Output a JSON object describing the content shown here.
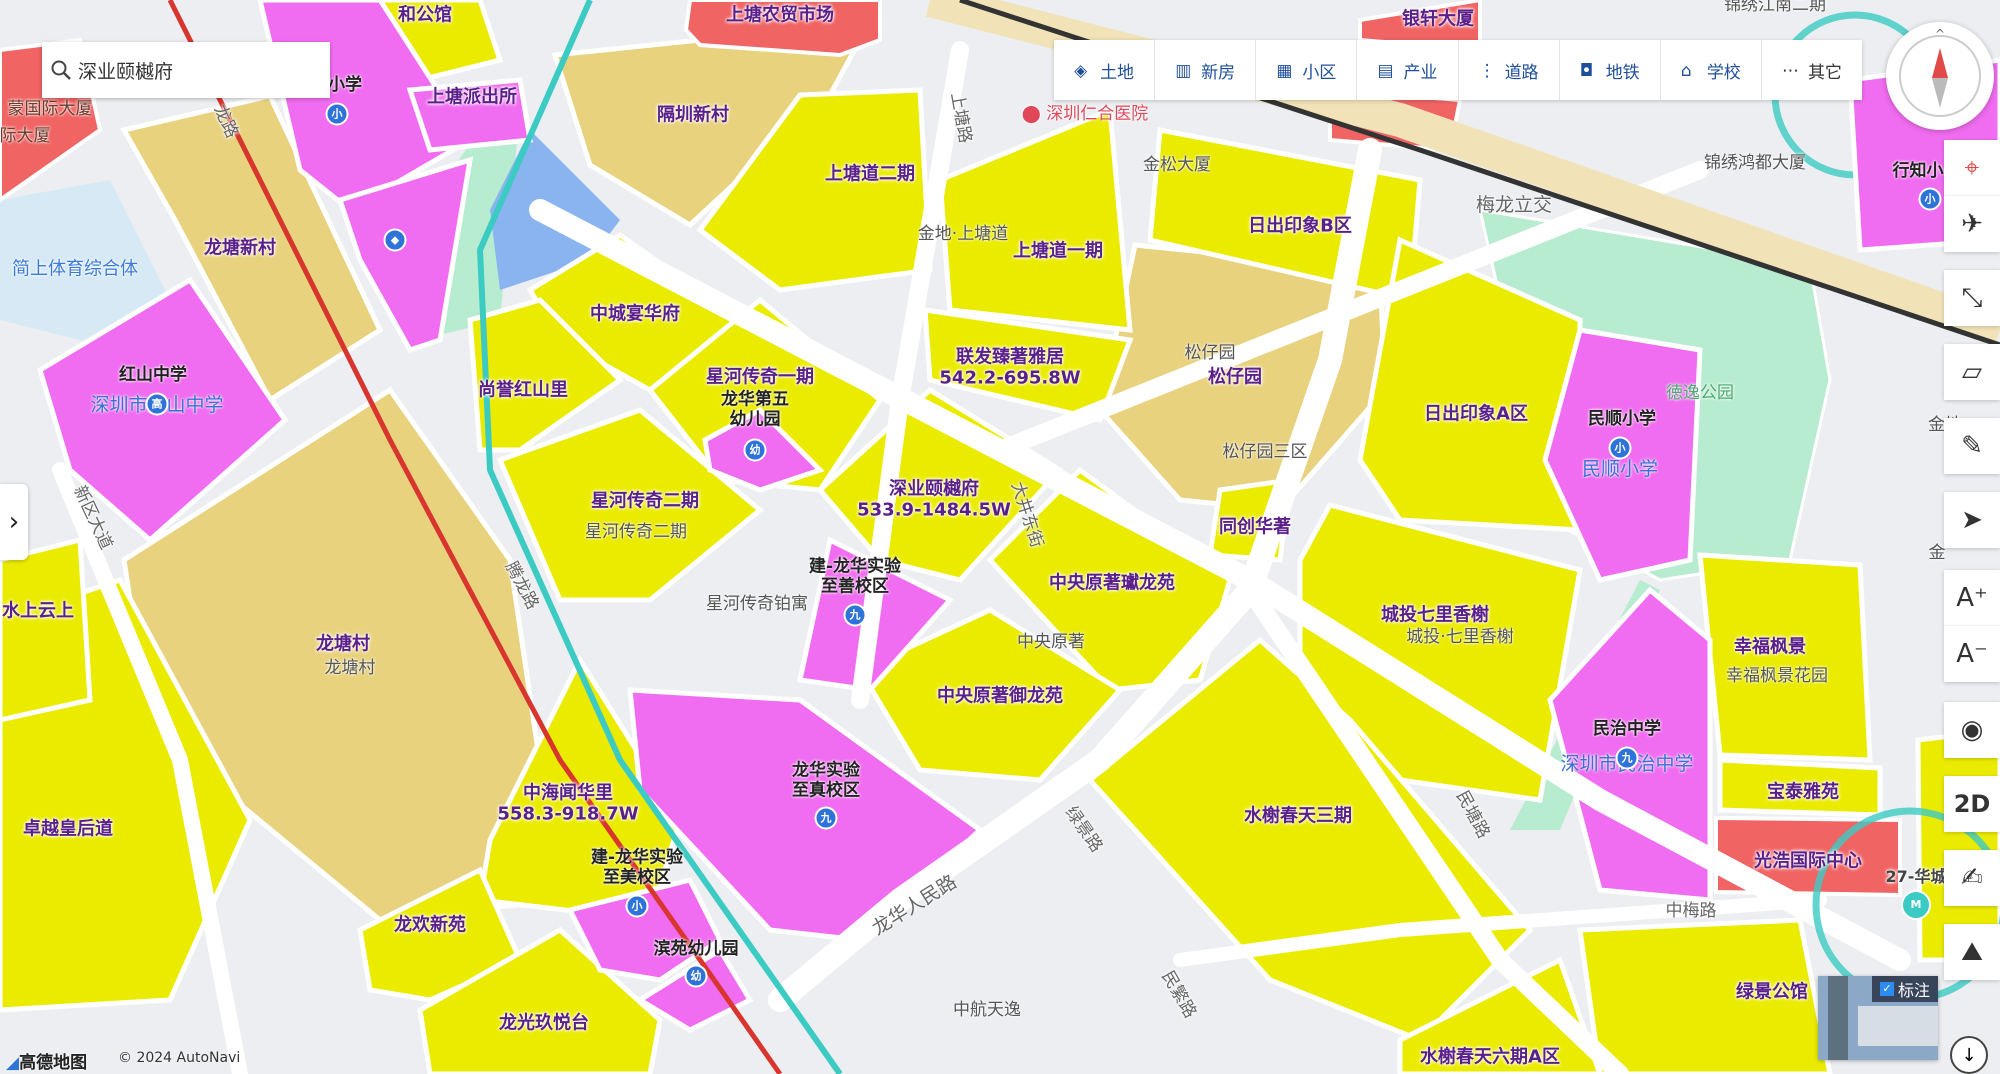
{
  "search": {
    "value": "深业颐樾府"
  },
  "categories": [
    {
      "label": "土地",
      "icon": "land-icon"
    },
    {
      "label": "新房",
      "icon": "building-icon"
    },
    {
      "label": "小区",
      "icon": "community-icon"
    },
    {
      "label": "产业",
      "icon": "factory-icon"
    },
    {
      "label": "道路",
      "icon": "road-icon"
    },
    {
      "label": "地铁",
      "icon": "metro-icon"
    },
    {
      "label": "学校",
      "icon": "school-icon"
    },
    {
      "label": "其它",
      "icon": "more-icon"
    }
  ],
  "parcels": [
    {
      "name": "和公馆"
    },
    {
      "name": "上塘派出所"
    },
    {
      "name": "隔圳新村"
    },
    {
      "name": "上塘道二期"
    },
    {
      "name": "上塘道一期"
    },
    {
      "name": "日出印象B区"
    },
    {
      "name": "龙塘新村"
    },
    {
      "name": "中城宴华府"
    },
    {
      "name": "星河传奇一期"
    },
    {
      "name": "尚誉红山里"
    },
    {
      "name": "联发臻著雅居",
      "price": "542.2-695.8W"
    },
    {
      "name": "松仔园"
    },
    {
      "name": "日出印象A区"
    },
    {
      "name": "星河传奇二期"
    },
    {
      "name": "深业颐樾府",
      "price": "533.9-1484.5W"
    },
    {
      "name": "同创华著"
    },
    {
      "name": "中央原著瓛龙苑"
    },
    {
      "name": "城投七里香榭"
    },
    {
      "name": "幸福枫景"
    },
    {
      "name": "龙塘村"
    },
    {
      "name": "中央原著御龙苑"
    },
    {
      "name": "中海闻华里",
      "price": "558.3-918.7W"
    },
    {
      "name": "水榭春天三期"
    },
    {
      "name": "宝泰雅苑"
    },
    {
      "name": "光浩国际中心"
    },
    {
      "name": "卓越皇后道"
    },
    {
      "name": "龙欢新苑"
    },
    {
      "name": "龙光玖悦台"
    },
    {
      "name": "水榭春天六期A区"
    },
    {
      "name": "绿景公馆"
    },
    {
      "name": "银轩大厦"
    },
    {
      "name": "上塘农贸市场"
    },
    {
      "name": "水上云上"
    },
    {
      "name": "龙华第五幼儿园"
    },
    {
      "name": "滨苑幼儿园"
    }
  ],
  "schools": [
    {
      "name": "红山中学",
      "sub": "深圳市红山中学",
      "badge": "高"
    },
    {
      "name": "民顺小学",
      "sub": "民顺小学",
      "badge": "小"
    },
    {
      "name": "民治中学",
      "sub": "深圳市民治中学",
      "badge": "九"
    },
    {
      "name": "建-龙华实验至善校区",
      "badge": "九"
    },
    {
      "name": "龙华实验至真校区",
      "badge": "九"
    },
    {
      "name": "建-龙华实验至美校区",
      "badge": "小"
    },
    {
      "name": "行知小",
      "badge": "小"
    },
    {
      "name": "小学",
      "badge": "小"
    }
  ],
  "pois": [
    {
      "name": "深圳仁合医院"
    },
    {
      "name": "金松大厦"
    },
    {
      "name": "金地·上塘道"
    },
    {
      "name": "锦绣鸿都大厦"
    },
    {
      "name": "锦绣江南二期"
    },
    {
      "name": "松仔园"
    },
    {
      "name": "松仔园三区"
    },
    {
      "name": "星河传奇二期"
    },
    {
      "name": "星河传奇铂寓"
    },
    {
      "name": "中央原著"
    },
    {
      "name": "龙塘村"
    },
    {
      "name": "城投·七里香榭"
    },
    {
      "name": "幸福枫景花园"
    },
    {
      "name": "中航天逸"
    },
    {
      "name": "简上体育综合体"
    },
    {
      "name": "徳逸公园"
    },
    {
      "name": "蒙国际大厦"
    },
    {
      "name": "际大厦"
    },
    {
      "name": "金地"
    },
    {
      "name": "金"
    }
  ],
  "roads": [
    {
      "name": "梅龙立交"
    },
    {
      "name": "上塘路"
    },
    {
      "name": "龙华人民路"
    },
    {
      "name": "民塘路"
    },
    {
      "name": "绿景路"
    },
    {
      "name": "民繁路"
    },
    {
      "name": "中梅路"
    },
    {
      "name": "腾龙路"
    },
    {
      "name": "大井东街"
    },
    {
      "name": "新区大道"
    },
    {
      "name": "龙路"
    }
  ],
  "metro": {
    "station": "27-华城"
  },
  "thumbnail": {
    "label": "标注",
    "checked": true
  },
  "footer": {
    "logo": "高德地图",
    "copyright": "© 2024 AutoNavi"
  },
  "tools": {
    "mode": "2D",
    "zoom_in": "A⁺",
    "zoom_out": "A⁻"
  },
  "colors": {
    "residential": "#ebeb00",
    "school": "#f06cf0",
    "village": "#e8d27e",
    "commercial": "#f06464",
    "park": "#b8ecd0",
    "water": "#8ab4f0"
  }
}
